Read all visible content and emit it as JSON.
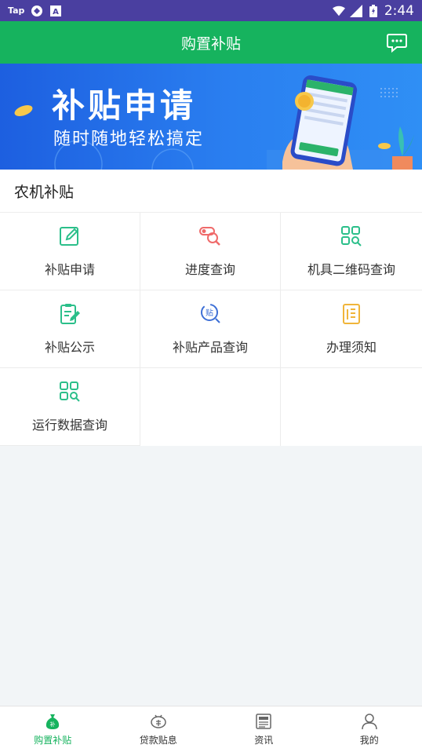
{
  "status_bar": {
    "left_text": "Tap",
    "time": "2:44",
    "icons": [
      "tap-app-icon",
      "sync-icon",
      "a-box-icon",
      "wifi-icon",
      "signal-icon",
      "battery-icon"
    ]
  },
  "app_bar": {
    "title": "购置补贴",
    "action_icon": "message-icon"
  },
  "banner": {
    "title": "补贴申请",
    "subtitle": "随时随地轻松搞定"
  },
  "section": {
    "title": "农机补贴",
    "items": [
      {
        "label": "补贴申请",
        "icon": "edit-icon"
      },
      {
        "label": "进度查询",
        "icon": "progress-search-icon"
      },
      {
        "label": "机具二维码查询",
        "icon": "qr-search-icon"
      },
      {
        "label": "补贴公示",
        "icon": "clipboard-edit-icon"
      },
      {
        "label": "补贴产品查询",
        "icon": "subsidy-search-icon"
      },
      {
        "label": "办理须知",
        "icon": "notice-icon"
      },
      {
        "label": "运行数据查询",
        "icon": "data-search-icon"
      }
    ]
  },
  "bottom_nav": {
    "items": [
      {
        "label": "购置补贴",
        "icon": "money-bag-icon",
        "active": true
      },
      {
        "label": "贷款贴息",
        "icon": "piggy-icon",
        "active": false
      },
      {
        "label": "资讯",
        "icon": "news-icon",
        "active": false
      },
      {
        "label": "我的",
        "icon": "user-icon",
        "active": false
      }
    ]
  },
  "colors": {
    "primary_green": "#16b35e",
    "status_bar": "#4a3fa0",
    "banner_blue": "#2a7ff0"
  }
}
